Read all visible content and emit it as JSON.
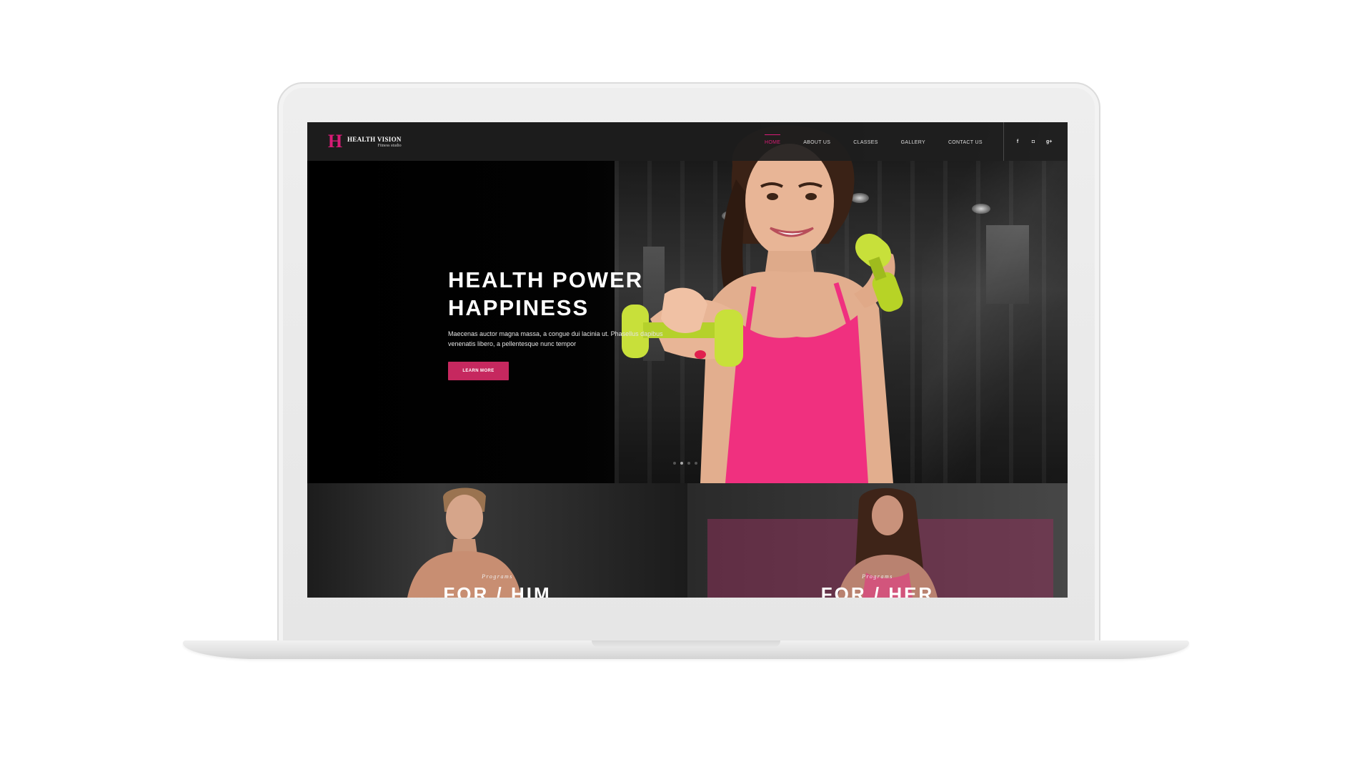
{
  "brand": {
    "mark": "H",
    "name": "HEALTH VISION",
    "tagline": "Fitness studio",
    "accent_color": "#d81b76"
  },
  "nav": {
    "items": [
      {
        "label": "HOME",
        "active": true
      },
      {
        "label": "ABOUT US",
        "active": false
      },
      {
        "label": "CLASSES",
        "active": false
      },
      {
        "label": "GALLERY",
        "active": false
      },
      {
        "label": "CONTACT US",
        "active": false
      }
    ],
    "social": [
      {
        "icon": "facebook-icon",
        "glyph": "f"
      },
      {
        "icon": "instagram-icon",
        "glyph": "◘"
      },
      {
        "icon": "google-plus-icon",
        "glyph": "g+"
      }
    ]
  },
  "hero": {
    "title_line1": "HEALTH POWER",
    "title_line2": "HAPPINESS",
    "text": "Maecenas auctor magna massa, a congue dui lacinia ut. Phasellus dapibus venenatis libero, a pellentesque nunc tempor",
    "button_label": "LEARN MORE",
    "button_color": "#c6285f",
    "slides": 4,
    "active_slide": 2
  },
  "programs": [
    {
      "label": "Programs",
      "title": "FOR / HIM"
    },
    {
      "label": "Programs",
      "title": "FOR / HER"
    }
  ]
}
